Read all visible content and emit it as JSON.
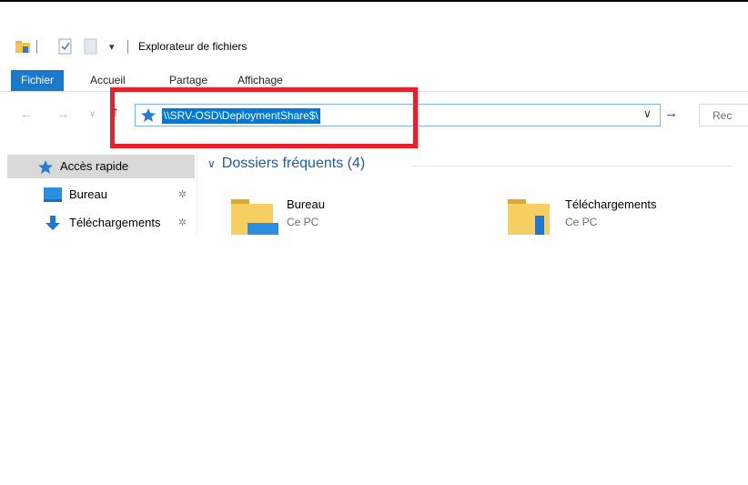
{
  "window": {
    "title": "Explorateur de fichiers"
  },
  "ribbon": {
    "tabs": [
      "Fichier",
      "Accueil",
      "Partage",
      "Affichage"
    ]
  },
  "address_bar": {
    "path": "\\\\SRV-OSD\\DeploymentShare$\\",
    "search_placeholder": "Rec"
  },
  "sidebar": {
    "items": [
      {
        "label": "Accès rapide",
        "icon": "quick-access-star-icon"
      },
      {
        "label": "Bureau",
        "icon": "desktop-folder-icon"
      },
      {
        "label": "Téléchargements",
        "icon": "download-arrow-icon"
      }
    ]
  },
  "content": {
    "group_title": "Dossiers fréquents (4)",
    "folders": [
      {
        "name": "Bureau",
        "location": "Ce PC"
      },
      {
        "name": "Téléchargements",
        "location": "Ce PC"
      }
    ]
  },
  "colors": {
    "accent": "#1979ca",
    "selection": "#0078d7",
    "highlight_box": "#e8202a",
    "group_title": "#1e5aa8"
  }
}
